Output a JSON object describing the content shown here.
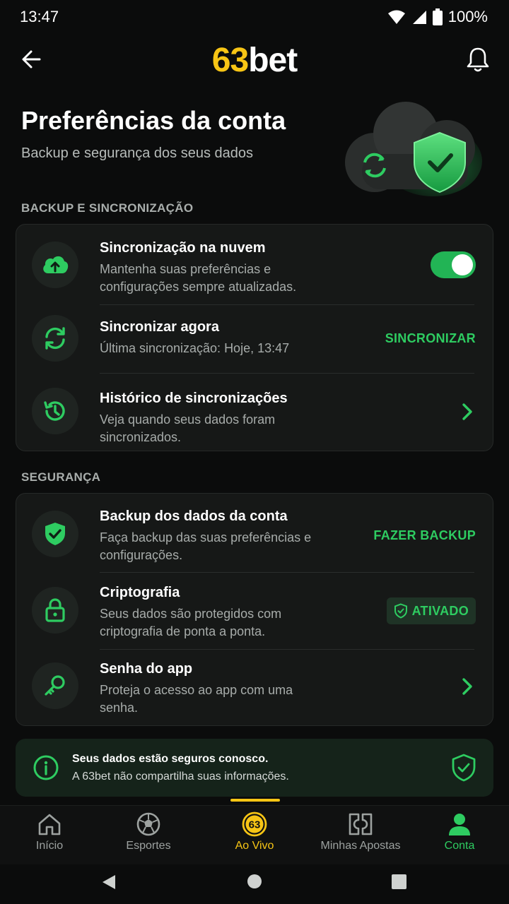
{
  "status_bar": {
    "time": "13:47",
    "battery": "100%"
  },
  "header": {
    "logo_number": "63",
    "logo_text": "bet"
  },
  "page": {
    "title": "Preferências da conta",
    "subtitle": "Backup e segurança dos seus dados"
  },
  "sections": {
    "backup": {
      "label": "BACKUP E SINCRONIZAÇÃO",
      "rows": [
        {
          "title": "Sincronização na nuvem",
          "desc": "Mantenha suas preferências e configurações sempre atualizadas.",
          "toggle_on": true
        },
        {
          "title": "Sincronizar agora",
          "desc": "Última sincronização: Hoje, 13:47",
          "action": "SINCRONIZAR"
        },
        {
          "title": "Histórico de sincronizações",
          "desc": "Veja quando seus dados foram sincronizados."
        }
      ]
    },
    "security": {
      "label": "SEGURANÇA",
      "rows": [
        {
          "title": "Backup dos dados da conta",
          "desc": "Faça backup das suas preferências e configurações.",
          "action": "FAZER BACKUP"
        },
        {
          "title": "Criptografia",
          "desc": "Seus dados são protegidos com criptografia de ponta a ponta.",
          "status": "ATIVADO"
        },
        {
          "title": "Senha do app",
          "desc": "Proteja o acesso ao app com uma senha."
        }
      ]
    }
  },
  "notice": {
    "line1": "Seus dados estão seguros conosco.",
    "line2": "A 63bet não compartilha suas informações."
  },
  "bottom_nav": {
    "items": [
      {
        "label": "Início"
      },
      {
        "label": "Esportes"
      },
      {
        "label": "Ao Vivo",
        "badge": "63"
      },
      {
        "label": "Minhas Apostas"
      },
      {
        "label": "Conta"
      }
    ]
  },
  "colors": {
    "accent_green": "#2ecc61",
    "brand_yellow": "#f7c515",
    "background": "#0b0c0c"
  },
  "icons": [
    "arrow-left-icon",
    "bell-icon",
    "cloud-upload-icon",
    "sync-icon",
    "history-icon",
    "shield-check-icon",
    "lock-icon",
    "key-icon",
    "info-icon",
    "home-icon",
    "soccer-ball-icon",
    "live-icon",
    "ticket-icon",
    "user-icon"
  ]
}
